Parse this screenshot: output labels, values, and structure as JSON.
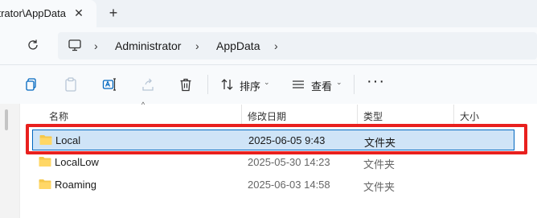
{
  "window": {
    "tab_title": "istrator\\AppData",
    "close_tab_glyph": "✕",
    "new_tab_glyph": "+"
  },
  "address_bar": {
    "refresh_icon": "refresh-icon",
    "location_icon": "computer-icon",
    "separator_glyph": "›",
    "breadcrumbs": [
      "Administrator",
      "AppData"
    ]
  },
  "command_bar": {
    "cut_icon": "cut-icon",
    "copy_icon": "copy-icon",
    "rename_icon": "rename-icon",
    "share_icon": "share-icon",
    "delete_icon": "delete-icon",
    "sort_label": "排序",
    "view_label": "查看",
    "caret_glyph": "⌄",
    "more_glyph": "···"
  },
  "file_list": {
    "columns": [
      "名称",
      "修改日期",
      "类型",
      "大小"
    ],
    "sort_indicator": "^",
    "rows": [
      {
        "name": "Local",
        "modified": "2025-06-05 9:43",
        "type": "文件夹",
        "selected": true
      },
      {
        "name": "LocalLow",
        "modified": "2025-05-30 14:23",
        "type": "文件夹",
        "selected": false
      },
      {
        "name": "Roaming",
        "modified": "2025-06-03 14:58",
        "type": "文件夹",
        "selected": false
      }
    ]
  },
  "colors": {
    "selection_fill": "#cfe4f7",
    "selection_border": "#0067c0",
    "annotation_red": "#e8201e",
    "folder_yellow": "#f5c84c"
  }
}
